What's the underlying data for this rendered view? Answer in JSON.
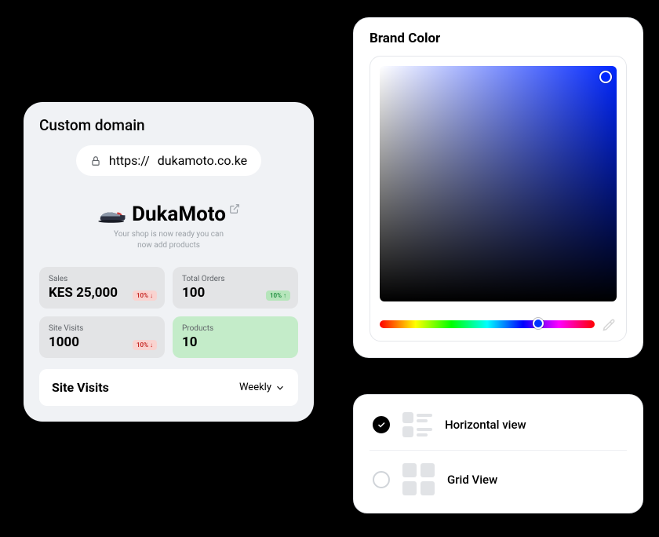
{
  "dashboard": {
    "domain_section_title": "Custom domain",
    "domain_protocol": "https://",
    "domain_name": "dukamoto.co.ke",
    "shop_name": "DukaMoto",
    "shop_subtitle_l1": "Your shop is now ready you can",
    "shop_subtitle_l2": "now add products",
    "stats": [
      {
        "label": "Sales",
        "value": "KES 25,000",
        "badge": "10% ↓",
        "badge_type": "red"
      },
      {
        "label": "Total Orders",
        "value": "100",
        "badge": "10% ↑",
        "badge_type": "greenb"
      },
      {
        "label": "Site Visits",
        "value": "1000",
        "badge": "10% ↓",
        "badge_type": "red"
      },
      {
        "label": "Products",
        "value": "10",
        "badge": "",
        "badge_type": ""
      }
    ],
    "visits_title": "Site Visits",
    "period": "Weekly"
  },
  "color": {
    "title": "Brand Color",
    "selected_hex": "#0026ff",
    "hue_position_pct": 71
  },
  "views": {
    "options": [
      {
        "label": "Horizontal view",
        "checked": true
      },
      {
        "label": "Grid View",
        "checked": false
      }
    ]
  }
}
